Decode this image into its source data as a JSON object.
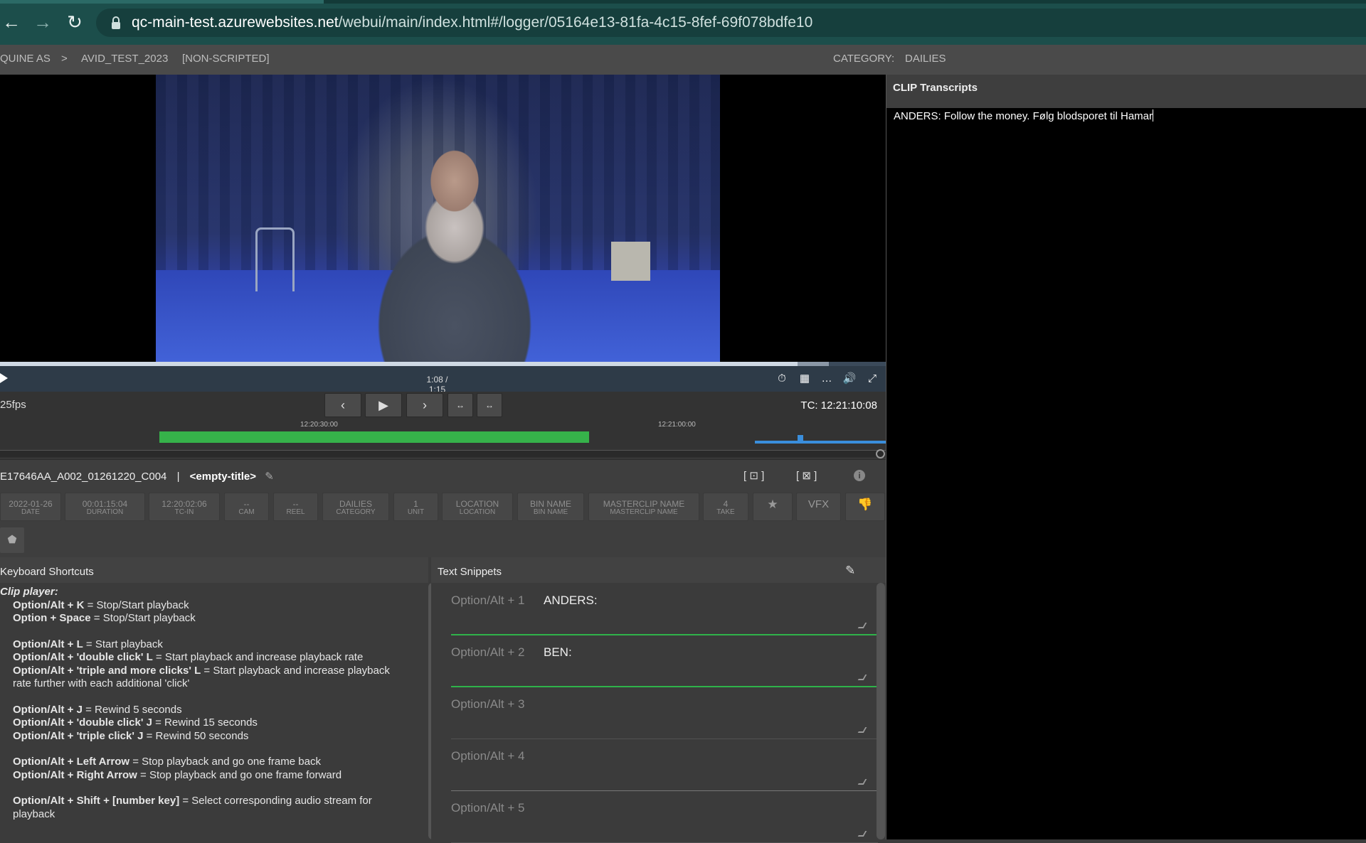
{
  "browser": {
    "url_host": "qc-main-test.azurewebsites.net",
    "url_path": "/webui/main/index.html#/logger/05164e13-81fa-4c15-8fef-69f078bdfe10"
  },
  "topbar": {
    "breadcrumb_org": "QUINE AS",
    "breadcrumb_sep": ">",
    "breadcrumb_project": "AVID_TEST_2023",
    "breadcrumb_type": "[NON-SCRIPTED]",
    "category_label": "CATEGORY:",
    "category_value": "DAILIES"
  },
  "player": {
    "time": "1:08 / 1:15",
    "progress": 0.9,
    "fps": "25fps",
    "timecode": "TC: 12:21:10:08",
    "timeline_mark_1": "12:20:30:00",
    "timeline_mark_2": "12:21:00:00",
    "prev_glyph": "‹",
    "play_glyph": "▶",
    "next_glyph": "›",
    "mark_in_glyph": "↔",
    "mark_out_glyph": "↔"
  },
  "clip": {
    "name": "E17646AA_A002_01261220_C004",
    "separator": "|",
    "title": "<empty-title>"
  },
  "metadata": [
    {
      "value": "2022-01-26",
      "label": "DATE"
    },
    {
      "value": "00:01:15:04",
      "label": "DURATION"
    },
    {
      "value": "12:20:02:06",
      "label": "TC-IN"
    },
    {
      "value": "--",
      "label": "CAM"
    },
    {
      "value": "--",
      "label": "REEL"
    },
    {
      "value": "DAILIES",
      "label": "CATEGORY"
    },
    {
      "value": "1",
      "label": "UNIT"
    },
    {
      "value": "LOCATION",
      "label": "LOCATION"
    },
    {
      "value": "BIN NAME",
      "label": "BIN NAME"
    },
    {
      "value": "MASTERCLIP NAME",
      "label": "MASTERCLIP NAME"
    },
    {
      "value": "4",
      "label": "TAKE"
    }
  ],
  "vfx_label": "VFX",
  "shortcuts": {
    "title": "Keyboard Shortcuts",
    "section": "Clip player:",
    "lines": [
      {
        "key": "Option/Alt + K",
        "desc": " = Stop/Start playback"
      },
      {
        "key": "Option + Space",
        "desc": " = Stop/Start playback"
      },
      {
        "key": "Option/Alt + L",
        "desc": " = Start playback"
      },
      {
        "key": "Option/Alt + 'double click' L",
        "desc": " = Start playback and increase playback rate"
      },
      {
        "key": "Option/Alt + 'triple and more clicks' L",
        "desc": " = Start playback and increase playback"
      },
      {
        "key": "",
        "desc": "rate further with each additional 'click'"
      },
      {
        "key": "Option/Alt + J",
        "desc": " = Rewind 5 seconds"
      },
      {
        "key": "Option/Alt + 'double click' J",
        "desc": " = Rewind 15 seconds"
      },
      {
        "key": "Option/Alt + 'triple click' J",
        "desc": " = Rewind 50 seconds"
      },
      {
        "key": "Option/Alt + Left Arrow",
        "desc": " = Stop playback and go one frame back"
      },
      {
        "key": "Option/Alt + Right Arrow",
        "desc": " = Stop playback and go one frame forward"
      },
      {
        "key": "Option/Alt + Shift + [number key]",
        "desc": " = Select corresponding audio stream for"
      },
      {
        "key": "",
        "desc": "playback"
      }
    ]
  },
  "snippets": {
    "title": "Text Snippets",
    "items": [
      {
        "shortcut": "Option/Alt + 1",
        "text": "ANDERS:"
      },
      {
        "shortcut": "Option/Alt + 2",
        "text": "BEN:"
      },
      {
        "shortcut": "Option/Alt + 3",
        "text": ""
      },
      {
        "shortcut": "Option/Alt + 4",
        "text": ""
      },
      {
        "shortcut": "Option/Alt + 5",
        "text": ""
      }
    ]
  },
  "transcripts": {
    "title": "CLIP Transcripts",
    "text": "ANDERS: Follow the money. Følg blodsporet til Hamar"
  },
  "colors": {
    "accent_green": "#36b24a",
    "accent_blue": "#3a8edc",
    "browser_bar": "#1c4e4b"
  }
}
